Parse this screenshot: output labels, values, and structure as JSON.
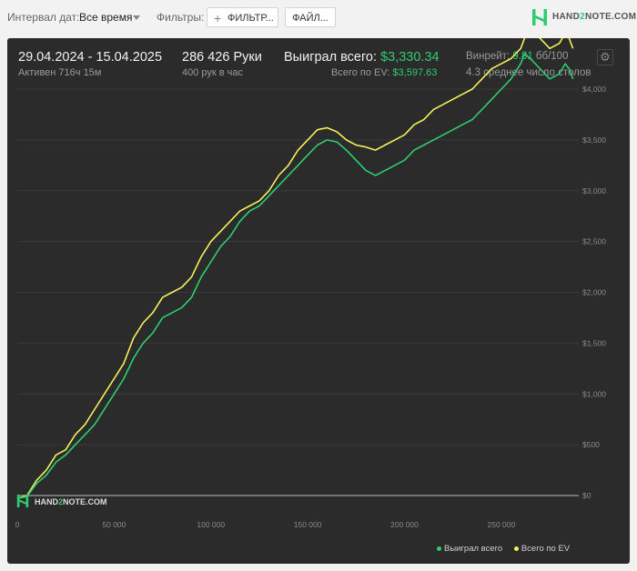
{
  "topbar": {
    "interval_label": "Интервал дат:",
    "interval_value": "Все время",
    "filters_label": "Фильтры:",
    "filter_button": "ФИЛЬТР...",
    "files_button": "ФАЙЛ...",
    "logo_text_a": "HAND",
    "logo_text_b": "2",
    "logo_text_c": "NOTE.COM"
  },
  "stats": {
    "date_range": "29.04.2024 - 15.04.2025",
    "active": "Активен 716ч 15м",
    "hands": "286 426 Руки",
    "hands_per_hour": "400 рук в час",
    "won_label": "Выиграл всего:",
    "won_value": "$3,330.34",
    "ev_label": "Всего по EV:",
    "ev_value": "$3,597.63",
    "winrate_label": "Винрейт:",
    "winrate_value": "9.81",
    "winrate_unit": "бб/100",
    "tables": "4.3 среднее число столов"
  },
  "watermark": {
    "a": "HAND",
    "b": "2",
    "c": "NOTE.COM"
  },
  "legend": {
    "won": "Выиграл всего",
    "ev": "Всего по EV"
  },
  "colors": {
    "won": "#2ecc71",
    "ev": "#f4f05a",
    "accent": "#2ecc71",
    "panel": "#2b2b2b"
  },
  "chart_data": {
    "type": "line",
    "xlim": [
      0,
      290000
    ],
    "ylim": [
      0,
      4000
    ],
    "grid": true,
    "x_ticks": [
      0,
      50000,
      100000,
      150000,
      200000,
      250000
    ],
    "x_tick_labels": [
      "0",
      "50 000",
      "100 000",
      "150 000",
      "200 000",
      "250 000"
    ],
    "y_ticks": [
      0,
      500,
      1000,
      1500,
      2000,
      2500,
      3000,
      3500,
      4000
    ],
    "y_tick_labels": [
      "$0",
      "$500",
      "$1,000",
      "$1,500",
      "$2,000",
      "$2,500",
      "$3,000",
      "$3,500",
      "$4,000"
    ],
    "legend_position": "bottom-right",
    "series": [
      {
        "name": "Всего по EV",
        "x": [
          0,
          5000,
          10000,
          15000,
          20000,
          25000,
          30000,
          35000,
          40000,
          45000,
          50000,
          55000,
          60000,
          65000,
          70000,
          75000,
          80000,
          85000,
          90000,
          95000,
          100000,
          105000,
          110000,
          115000,
          120000,
          125000,
          130000,
          135000,
          140000,
          145000,
          150000,
          155000,
          160000,
          165000,
          170000,
          175000,
          180000,
          185000,
          190000,
          195000,
          200000,
          205000,
          210000,
          215000,
          220000,
          225000,
          230000,
          235000,
          240000,
          245000,
          250000,
          255000,
          260000,
          262000,
          265000,
          270000,
          275000,
          280000,
          283000,
          285000,
          287000
        ],
        "values": [
          -30,
          0,
          150,
          250,
          400,
          450,
          600,
          700,
          850,
          1000,
          1150,
          1300,
          1550,
          1700,
          1800,
          1950,
          2000,
          2050,
          2150,
          2350,
          2500,
          2600,
          2700,
          2800,
          2850,
          2900,
          3000,
          3150,
          3250,
          3400,
          3500,
          3600,
          3620,
          3580,
          3500,
          3450,
          3430,
          3400,
          3450,
          3500,
          3550,
          3650,
          3700,
          3800,
          3850,
          3900,
          3950,
          4000,
          4100,
          4200,
          4250,
          4300,
          4400,
          4500,
          4550,
          4500,
          4400,
          4450,
          4550,
          4500,
          4400
        ]
      },
      {
        "name": "Выиграл всего",
        "x": [
          0,
          5000,
          10000,
          15000,
          20000,
          25000,
          30000,
          35000,
          40000,
          45000,
          50000,
          55000,
          60000,
          65000,
          70000,
          75000,
          80000,
          85000,
          90000,
          95000,
          100000,
          105000,
          110000,
          115000,
          120000,
          125000,
          130000,
          135000,
          140000,
          145000,
          150000,
          155000,
          160000,
          165000,
          170000,
          175000,
          180000,
          185000,
          190000,
          195000,
          200000,
          205000,
          210000,
          215000,
          220000,
          225000,
          230000,
          235000,
          240000,
          245000,
          250000,
          255000,
          260000,
          262000,
          265000,
          270000,
          275000,
          280000,
          283000,
          285000,
          287000
        ],
        "values": [
          -30,
          -10,
          120,
          200,
          330,
          400,
          500,
          600,
          700,
          850,
          1000,
          1150,
          1350,
          1500,
          1600,
          1750,
          1800,
          1850,
          1950,
          2150,
          2300,
          2450,
          2550,
          2700,
          2800,
          2850,
          2950,
          3050,
          3150,
          3250,
          3350,
          3450,
          3500,
          3480,
          3400,
          3300,
          3200,
          3150,
          3200,
          3250,
          3300,
          3400,
          3450,
          3500,
          3550,
          3600,
          3650,
          3700,
          3800,
          3900,
          4000,
          4100,
          4250,
          4350,
          4300,
          4200,
          4100,
          4150,
          4250,
          4200,
          4100
        ]
      }
    ]
  }
}
